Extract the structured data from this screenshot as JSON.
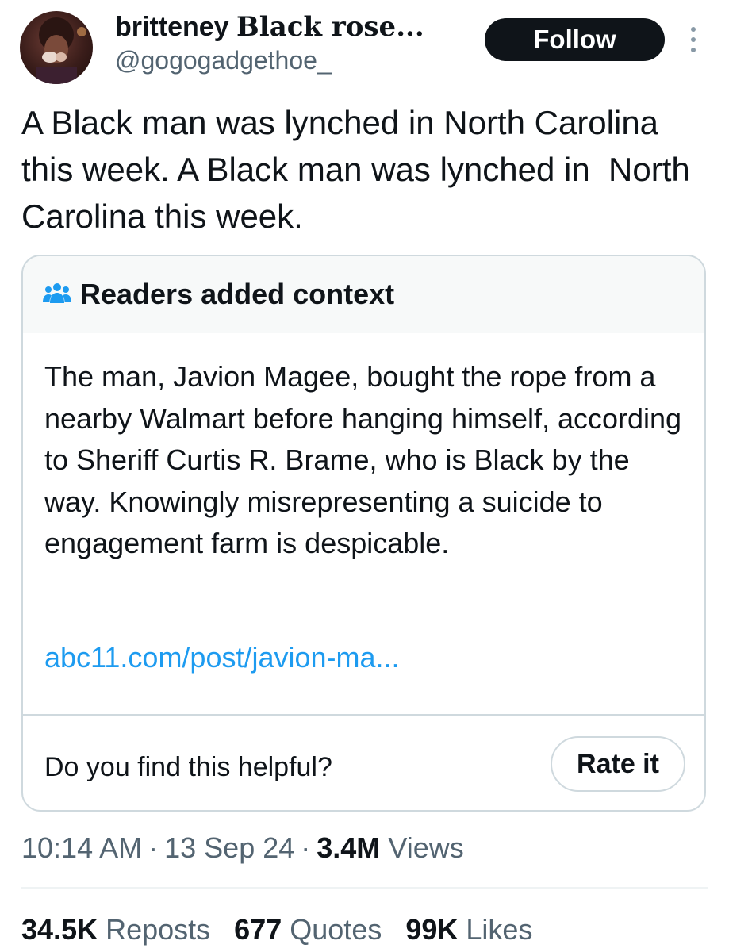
{
  "author": {
    "display_name_plain": "britteney ",
    "display_name_styled": "Black rose...",
    "handle": "@gogogadgethoe_",
    "avatar_icon": "profile-photo"
  },
  "follow_label": "Follow",
  "more_icon": "more-vertical-icon",
  "tweet_text": "A Black man was lynched in North Carolina this week. A Black man was lynched in  North Carolina this week.",
  "note": {
    "title": "Readers added context",
    "icon": "people-icon",
    "body": "The man, Javion Magee, bought the rope from a nearby Walmart before hanging himself, according to Sheriff Curtis R. Brame, who is Black by the way.  Knowingly misrepresenting a suicide to engagement farm is despicable.",
    "link": "abc11.com/post/javion-ma...",
    "helpful_question": "Do you find this helpful?",
    "rate_label": "Rate it"
  },
  "meta": {
    "time": "10:14 AM",
    "date": "13 Sep 24",
    "views_count": "3.4M",
    "views_label": "Views",
    "separator": "·"
  },
  "stats": {
    "reposts_count": "34.5K",
    "reposts_label": "Reposts",
    "quotes_count": "677",
    "quotes_label": "Quotes",
    "likes_count": "99K",
    "likes_label": "Likes"
  },
  "colors": {
    "text": "#0f1419",
    "secondary": "#536471",
    "link": "#1d9bf0",
    "border": "#cfd9de",
    "note_header_bg": "#f7f9f9"
  }
}
